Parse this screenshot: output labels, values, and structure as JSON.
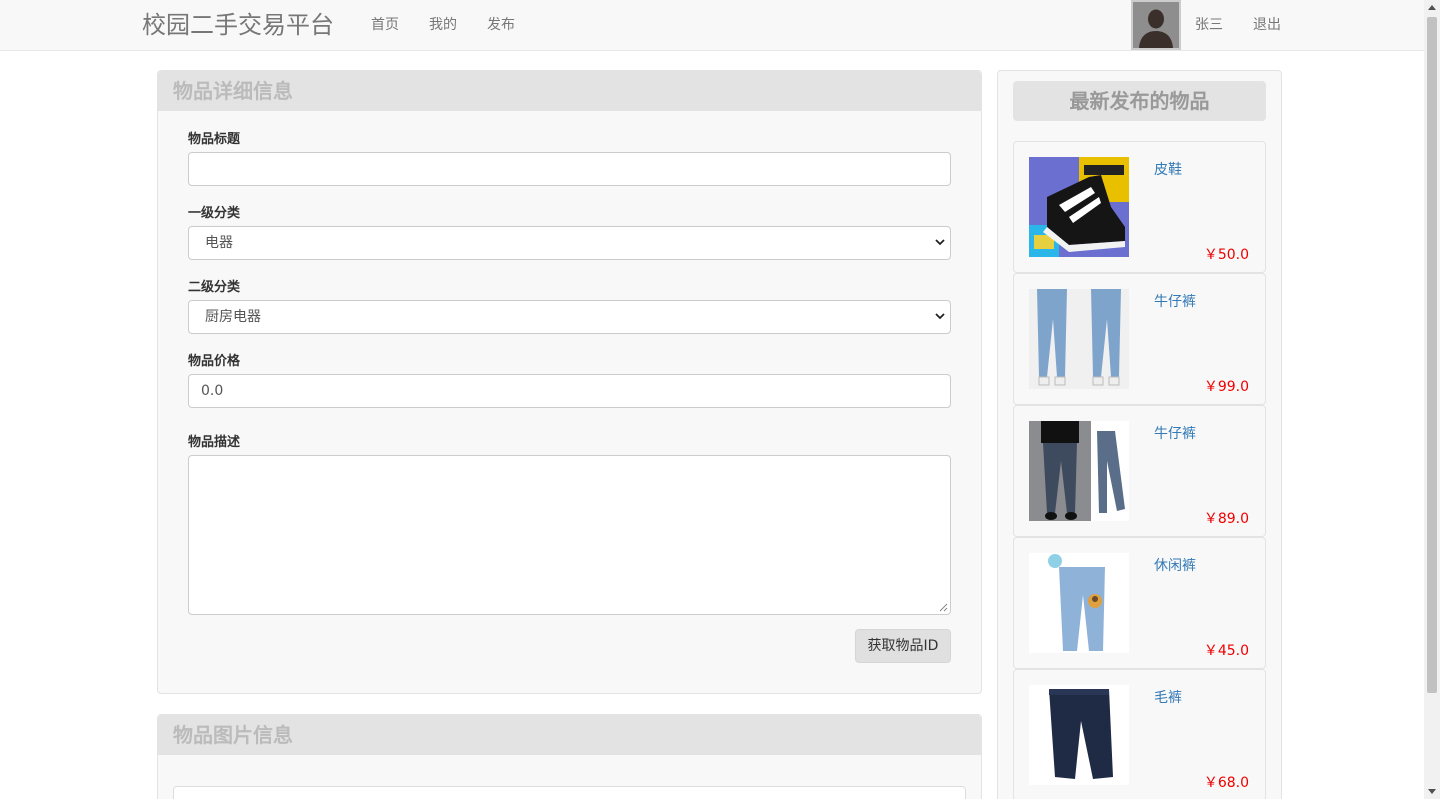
{
  "navbar": {
    "brand": "校园二手交易平台",
    "links": [
      "首页",
      "我的",
      "发布"
    ],
    "username": "张三",
    "logout": "退出"
  },
  "detail_panel": {
    "title": "物品详细信息",
    "fields": {
      "title_label": "物品标题",
      "title_value": "",
      "category1_label": "一级分类",
      "category1_value": "电器",
      "category2_label": "二级分类",
      "category2_value": "厨房电器",
      "price_label": "物品价格",
      "price_value": "0.0",
      "desc_label": "物品描述",
      "desc_value": ""
    },
    "get_id_button": "获取物品ID"
  },
  "image_panel": {
    "title": "物品图片信息"
  },
  "sidebar": {
    "title": "最新发布的物品",
    "items": [
      {
        "name": "皮鞋",
        "price": "￥50.0",
        "image": "black-sneaker"
      },
      {
        "name": "牛仔裤",
        "price": "￥99.0",
        "image": "light-jeans"
      },
      {
        "name": "牛仔裤",
        "price": "￥89.0",
        "image": "dark-jeans"
      },
      {
        "name": "休闲裤",
        "price": "￥45.0",
        "image": "blue-jeans-kids"
      },
      {
        "name": "毛裤",
        "price": "￥68.0",
        "image": "navy-pants"
      }
    ]
  }
}
